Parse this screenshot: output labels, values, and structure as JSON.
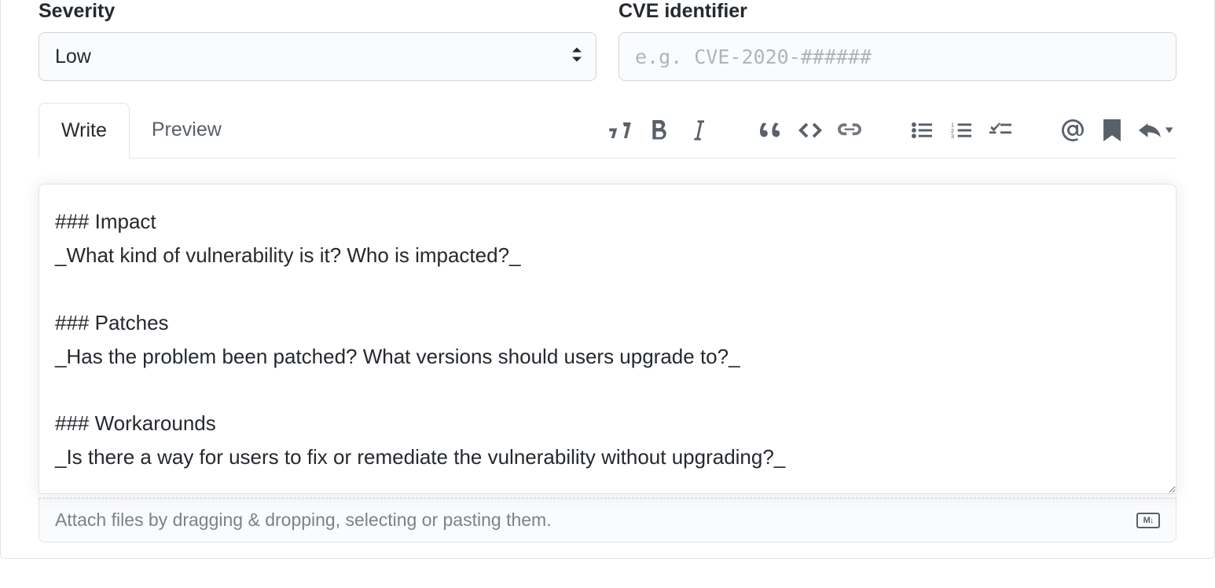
{
  "form": {
    "severity": {
      "label": "Severity",
      "value": "Low"
    },
    "cve": {
      "label": "CVE identifier",
      "placeholder": "e.g. CVE-2020-######",
      "value": ""
    }
  },
  "editor": {
    "tabs": {
      "write": "Write",
      "preview": "Preview"
    },
    "content": "### Impact\n_What kind of vulnerability is it? Who is impacted?_\n\n### Patches\n_Has the problem been patched? What versions should users upgrade to?_\n\n### Workarounds\n_Is there a way for users to fix or remediate the vulnerability without upgrading?_",
    "attach_hint": "Attach files by dragging & dropping, selecting or pasting them.",
    "md_badge": "M↓"
  }
}
